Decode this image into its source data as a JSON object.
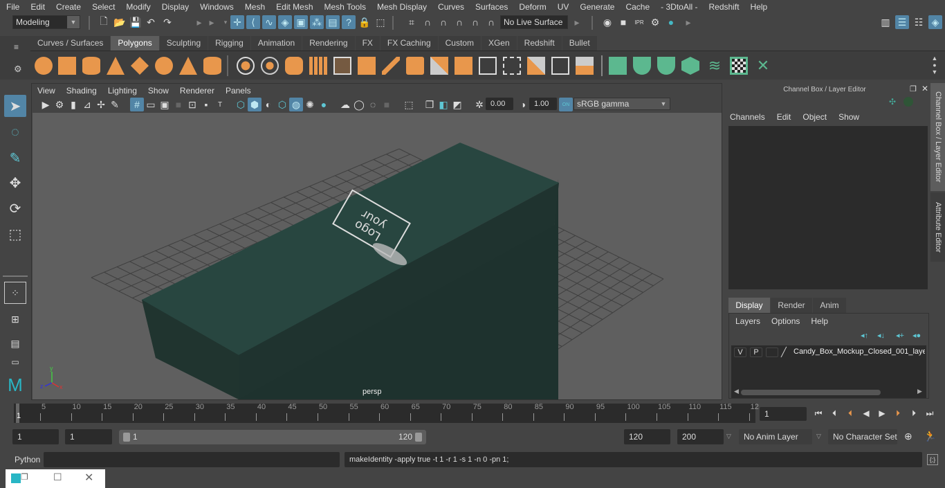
{
  "menubar": {
    "items": [
      "File",
      "Edit",
      "Create",
      "Select",
      "Modify",
      "Display",
      "Windows",
      "Mesh",
      "Edit Mesh",
      "Mesh Tools",
      "Mesh Display",
      "Curves",
      "Surfaces",
      "Deform",
      "UV",
      "Generate",
      "Cache",
      "- 3DtoAll -",
      "Redshift",
      "Help"
    ]
  },
  "statusline": {
    "workspace_mode": "Modeling",
    "live_surface": "No Live Surface"
  },
  "shelf": {
    "tabs": [
      "Curves / Surfaces",
      "Polygons",
      "Sculpting",
      "Rigging",
      "Animation",
      "Rendering",
      "FX",
      "FX Caching",
      "Custom",
      "XGen",
      "Redshift",
      "Bullet"
    ],
    "active_tab": "Polygons"
  },
  "viewport": {
    "menus": [
      "View",
      "Shading",
      "Lighting",
      "Show",
      "Renderer",
      "Panels"
    ],
    "exposure": "0.00",
    "gamma": "1.00",
    "color_mgmt_toggle": "ON",
    "color_space": "sRGB gamma",
    "camera_label": "persp",
    "logo_text_line1": "your",
    "logo_text_line2": "Logo",
    "axis": {
      "x": "x",
      "y": "y",
      "z": "z"
    }
  },
  "channel_box": {
    "title": "Channel Box / Layer Editor",
    "menus": [
      "Channels",
      "Edit",
      "Object",
      "Show"
    ],
    "side_tabs": [
      "Channel Box / Layer Editor",
      "Attribute Editor"
    ]
  },
  "layer_editor": {
    "tabs": [
      "Display",
      "Render",
      "Anim"
    ],
    "active_tab": "Display",
    "menus": [
      "Layers",
      "Options",
      "Help"
    ],
    "layers": [
      {
        "visible": "V",
        "playback": "P",
        "name": "Candy_Box_Mockup_Closed_001_laye"
      }
    ]
  },
  "timeline": {
    "ticks": [
      "5",
      "10",
      "15",
      "20",
      "25",
      "30",
      "35",
      "40",
      "45",
      "50",
      "55",
      "60",
      "65",
      "70",
      "75",
      "80",
      "85",
      "90",
      "95",
      "100",
      "105",
      "110",
      "115",
      "12"
    ],
    "current_frame_marker": "1",
    "current_frame": "1"
  },
  "range": {
    "start_frame": "1",
    "playback_start": "1",
    "range_slider_start": "1",
    "range_slider_end": "120",
    "playback_end": "120",
    "end_frame": "200",
    "anim_layer": "No Anim Layer",
    "character_set": "No Character Set"
  },
  "command_line": {
    "language": "Python",
    "input": "",
    "result": "makeIdentity -apply true -t 1 -r 1 -s 1 -n 0 -pn 1;"
  },
  "colors": {
    "accent_blue": "#5285a6",
    "shelf_orange": "#e8974c",
    "shelf_green": "#5cb88f",
    "box_top": "#284640",
    "box_side": "#1e322e",
    "viewport_bg": "#5f5f5f"
  }
}
